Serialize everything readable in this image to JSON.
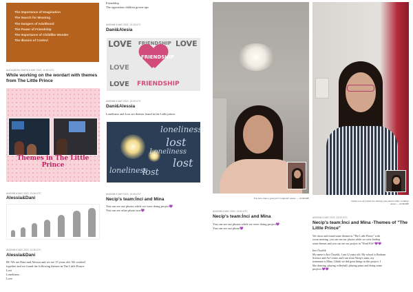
{
  "column1": {
    "themes_card": {
      "items": [
        "The Importance of Imagination",
        "The Search for Meaning",
        "The Dangers of Adulthood",
        "The Power of Friendship",
        "The Importance of Childlike Wonder",
        "The Illusion of Control"
      ]
    },
    "post1": {
      "meta": "ALEXANDRA CIMITA  6 MAY 2022, 11:40 UTC",
      "title": "While working on the wordart with themes from The Little Prince",
      "image_title": "Themes in The Little Prince"
    },
    "post2": {
      "meta": "ANONIM  6 MAY 2022, 13:36 UTC",
      "title": "Alessia&Dani"
    },
    "post3": {
      "meta": "ANONIM  6 MAY 2022, 13:39 UTC",
      "title": "Alessia&Dani",
      "body_lines": [
        "Hi! We are Dani and Alessia and we are 15 years old. We worked",
        "together and we found the following themes in The Little Prince:",
        "Lost",
        "Loneliness",
        "Love"
      ]
    }
  },
  "column2": {
    "top_text": [
      "Friendship",
      "The opposition children grown-ups"
    ],
    "post1": {
      "meta": "ANONIM  6 MAY 2022, 13:15 UTC",
      "title": "Dani&Alesia",
      "wordcloud_words": [
        "LOVE",
        "FRIENDSHIP",
        "LOVE",
        "FRIENDSHIP",
        "LOVE",
        "FRIENDSHIP",
        "LOVE"
      ]
    },
    "post2": {
      "meta": "ANONIM  6 MAY 2022, 13:29 UTC",
      "title": "Dani&Alessia",
      "body": "Loneliness and Lost are themes found in the Little prince.",
      "wordcloud_words": [
        "loneliness",
        "lost",
        "Loneliness",
        "lost",
        "loneliness",
        "lost"
      ]
    },
    "post3": {
      "meta": "ANONIM  6 MAY 2022, 13:45 UTC",
      "title": "Necip's team:İnci and Mina",
      "body_lines": [
        "You can see our photos while we were doing project💜",
        "You can see other photo now💜"
      ]
    }
  },
  "column3": {
    "caption": "You have done a great job! Congrats!! Aurea.  — AURORE",
    "post": {
      "meta": "ANONIM  6 MAY 2022, 13:52 UTC",
      "title": "Necip's team:İnci and Mina",
      "body_lines": [
        "You can see our photos while we were doing project💜",
        "You can see our photo💜"
      ]
    }
  },
  "column4": {
    "caption_lines": [
      "Thank you very much for sharing your photos while working!",
      "Aurea  — AURORE"
    ],
    "post": {
      "meta": "ANONIM  6 MAY 2022, 13:53 UTC",
      "title": "Necip's team:İnci and Mina -Themes of \"The Little Prince\"",
      "body_lines": [
        "We chose and found some themes in \"The Little Prince\" with",
        "zoom meeting. you can see our photos while we were finding",
        "some themes and you can see our project in \"Word File\"💜💜",
        "",
        "İnci Özçelik",
        "My name is İnci Özçelik. I am 12 years old. My school is Bodrum",
        "Science and Art Center and I am from Necip's team, my",
        "teammate is Mina. I think we did great things in this project. I",
        "like dancing, playing volleyball, playing piano and doing some",
        "projects.💜💜"
      ]
    }
  },
  "colors": {
    "orange_card": "#b5621e",
    "pink_title": "#c2185b",
    "heart": "#d14b7b"
  }
}
